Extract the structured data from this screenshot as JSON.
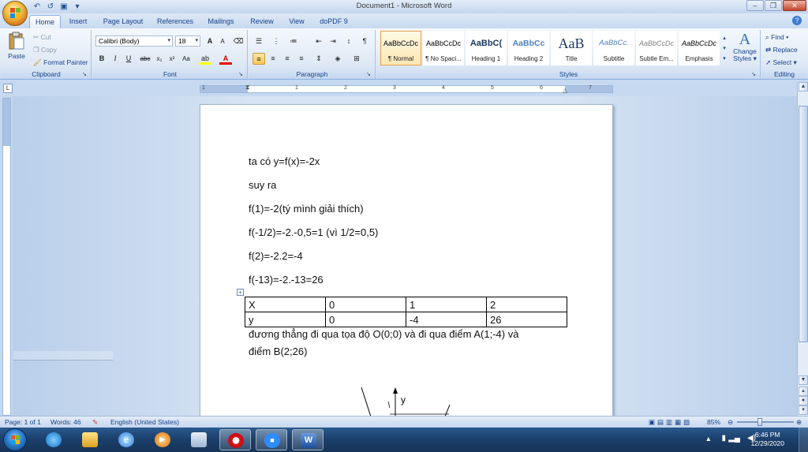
{
  "window": {
    "title": "Document1 - Microsoft Word",
    "minimize": "–",
    "restore": "❐",
    "close": "✕"
  },
  "quick_access": {
    "undo": "↶",
    "redo": "↺",
    "save": "▣",
    "more": "▾"
  },
  "tabs": [
    "Home",
    "Insert",
    "Page Layout",
    "References",
    "Mailings",
    "Review",
    "View",
    "doPDF 9"
  ],
  "active_tab": "Home",
  "ribbon": {
    "clipboard": {
      "label": "Clipboard",
      "paste": "Paste",
      "cut": "Cut",
      "copy": "Copy",
      "format_painter": "Format Painter"
    },
    "font": {
      "label": "Font",
      "family": "Calibri (Body)",
      "size": "18",
      "grow": "A",
      "shrink": "A"
    },
    "paragraph": {
      "label": "Paragraph"
    },
    "styles": {
      "label": "Styles",
      "items": [
        {
          "sample": "AaBbCcDc",
          "name": "¶ Normal"
        },
        {
          "sample": "AaBbCcDc",
          "name": "¶ No Spaci..."
        },
        {
          "sample": "AaBbC(",
          "name": "Heading 1"
        },
        {
          "sample": "AaBbCc",
          "name": "Heading 2"
        },
        {
          "sample": "AaB",
          "name": "Title"
        },
        {
          "sample": "AaBbCc.",
          "name": "Subtitle"
        },
        {
          "sample": "AaBbCcDc",
          "name": "Subtle Em..."
        },
        {
          "sample": "AaBbCcDc",
          "name": "Emphasis"
        }
      ],
      "change_styles": "Change Styles ▾"
    },
    "editing": {
      "label": "Editing",
      "find": "Find ▾",
      "replace": "Replace",
      "select": "Select ▾"
    }
  },
  "ruler_numbers": [
    "1",
    "1",
    "2",
    "3",
    "4",
    "5",
    "6",
    "7"
  ],
  "document": {
    "lines": [
      "ta có y=f(x)=-2x",
      "suy ra",
      "f(1)=-2(tý mình giải thích)",
      "f(-1/2)=-2.-0,5=1 (vì 1/2=0,5)",
      "f(2)=-2.2=-4",
      "f(-13)=-2.-13=26"
    ],
    "table": [
      [
        "X",
        "0",
        "1",
        "2"
      ],
      [
        "y",
        "0",
        "-4",
        "26"
      ]
    ],
    "after_table": [
      "đương thẳng đi qua tọa độ O(0;0) và đi qua điểm A(1;-4) và",
      "điểm B(2;26)"
    ],
    "graph_label": "y"
  },
  "status": {
    "page": "Page: 1 of 1",
    "words": "Words: 46",
    "language": "English (United States)",
    "zoom": "85%"
  },
  "taskbar": {
    "time": "6:46 PM",
    "date": "12/29/2020"
  },
  "colors": {
    "accent": "#15428b",
    "ribbon": "#dfe9f5",
    "taskbar": "#1b3e6a"
  }
}
